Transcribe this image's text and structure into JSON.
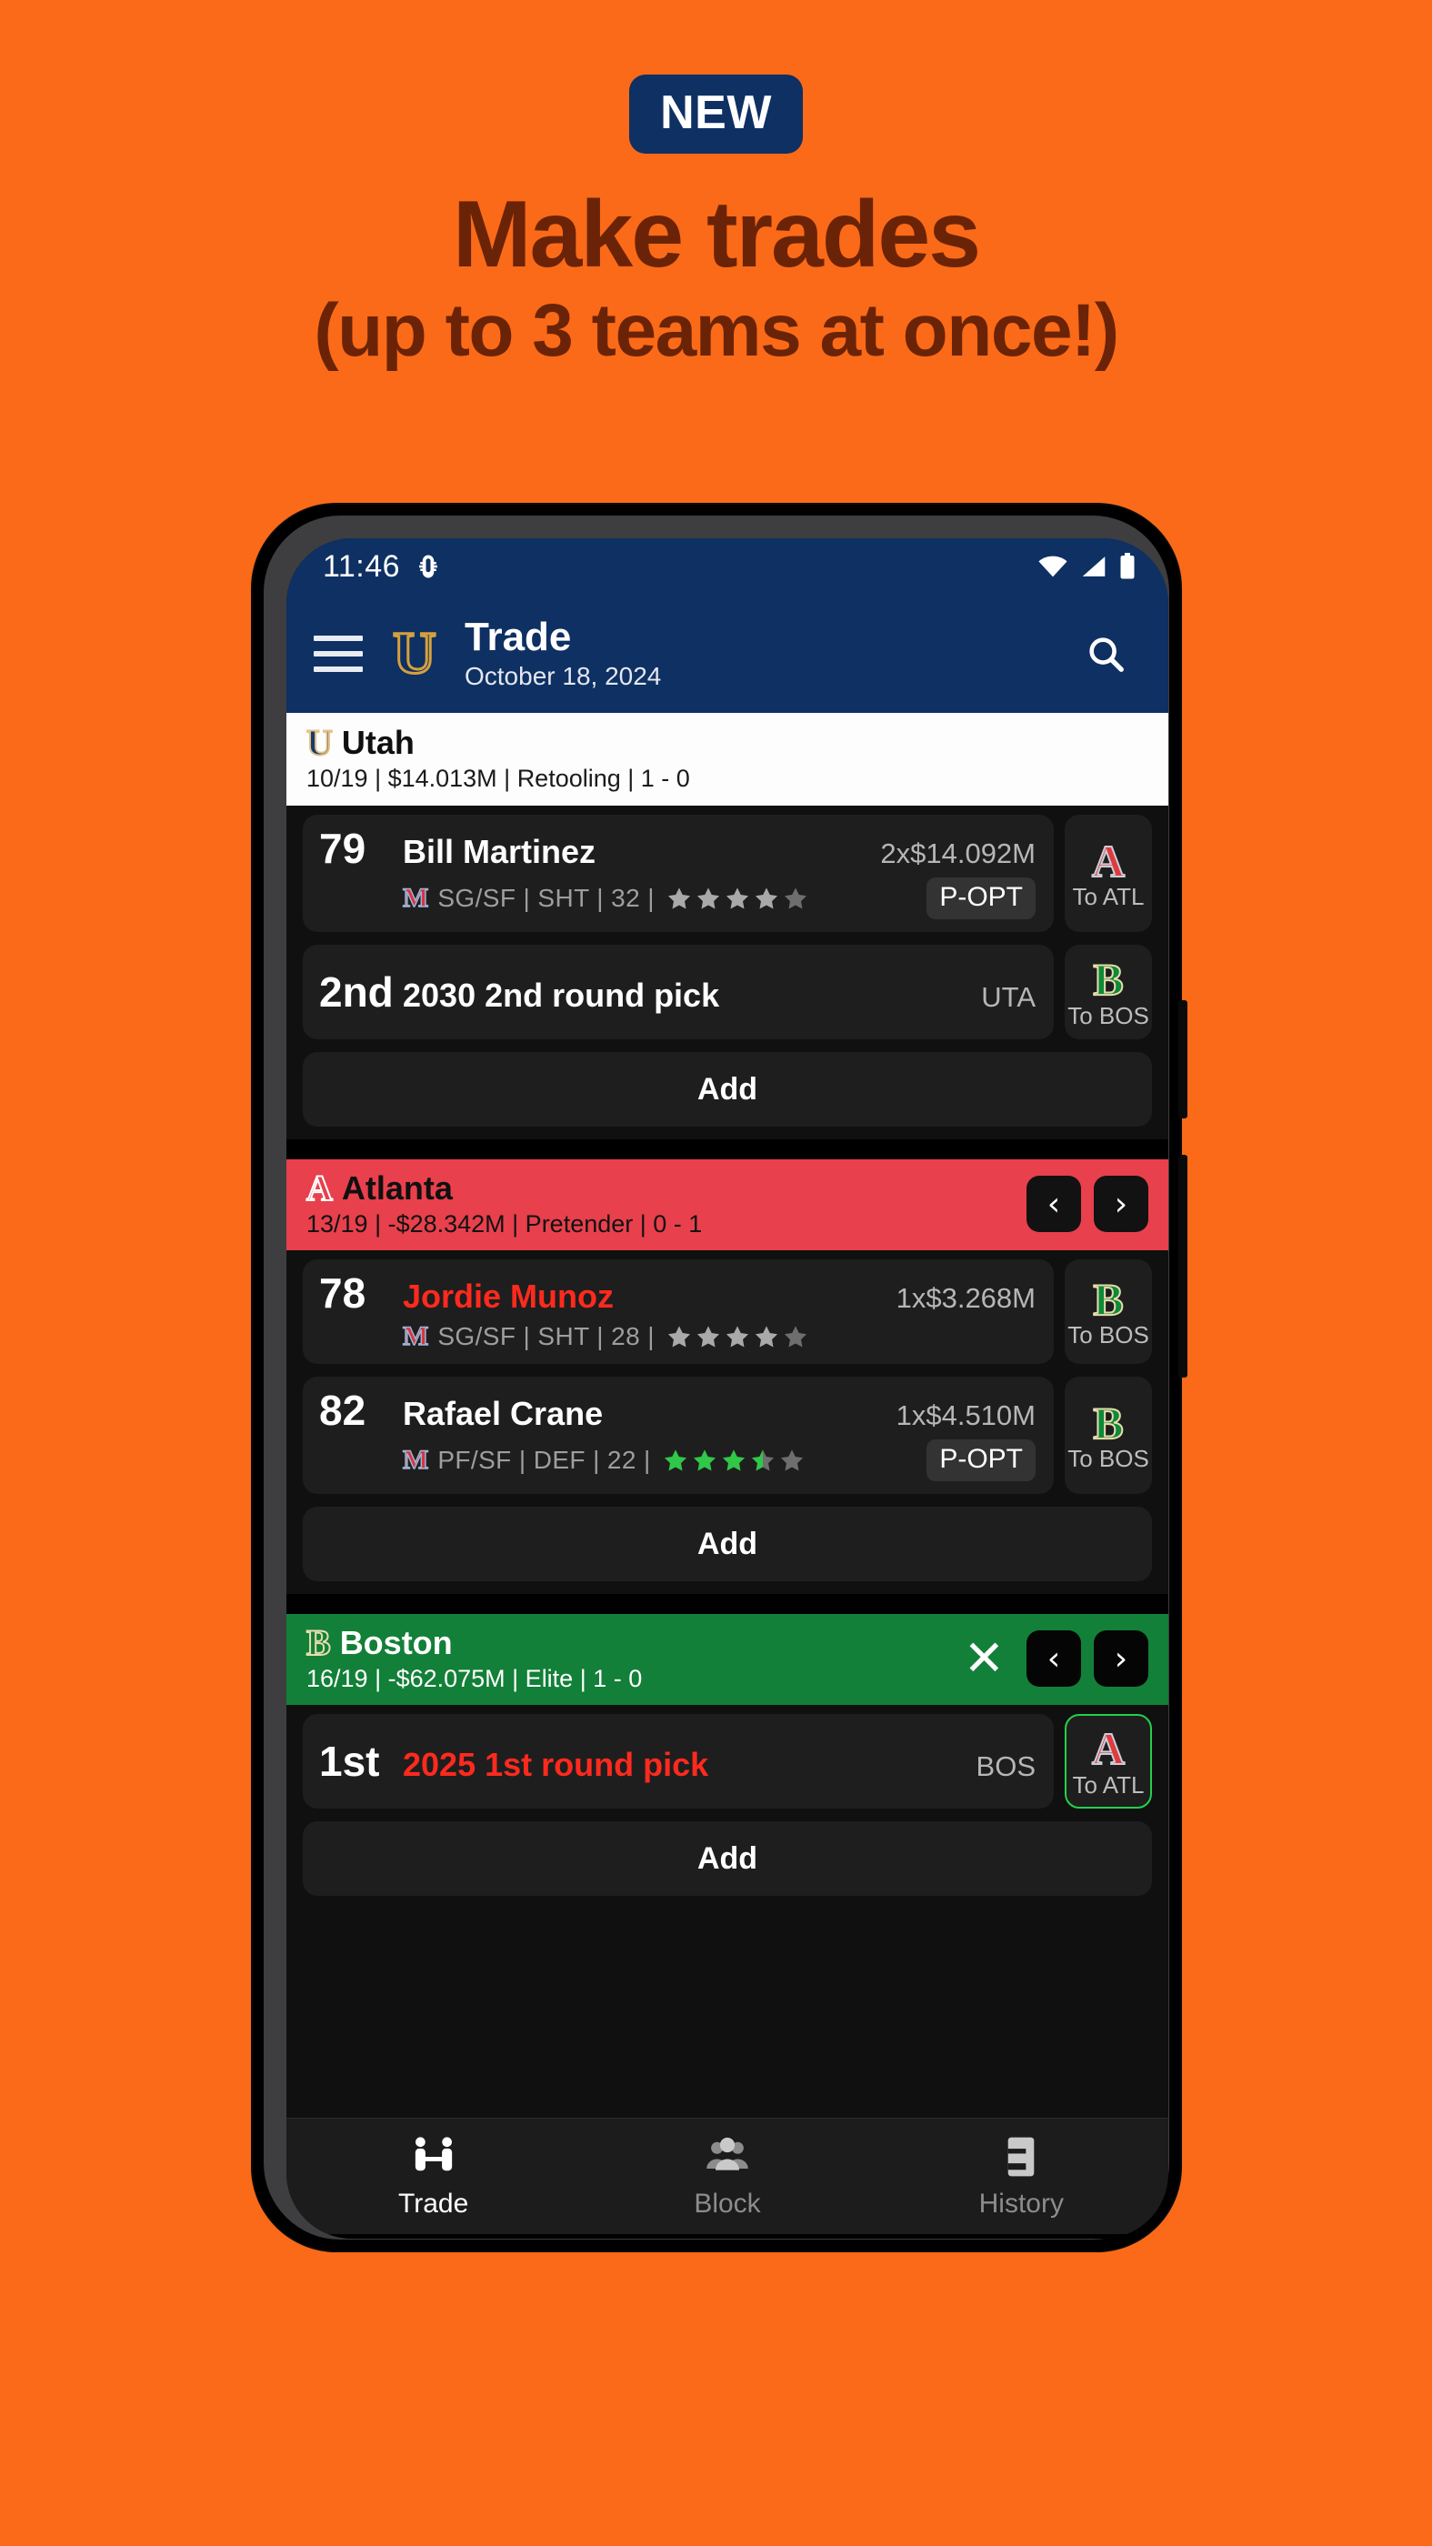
{
  "promo": {
    "badge": "NEW",
    "headline": "Make trades",
    "subheadline": "(up to 3 teams at once!)",
    "bg_color": "#FA6A18",
    "badge_bg": "#0E3063",
    "headline_color": "#6B2307"
  },
  "status_bar": {
    "time": "11:46",
    "left_icon": "bug-icon",
    "icons": [
      "wifi-icon",
      "signal-icon",
      "battery-icon"
    ]
  },
  "app_bar": {
    "menu_icon": "hamburger-menu-icon",
    "logo": "U",
    "title": "Trade",
    "date": "October 18, 2024",
    "search_icon": "search-icon",
    "bg_color": "#0E3063"
  },
  "teams": [
    {
      "id": "utah",
      "mark": "U",
      "name": "Utah",
      "meta": "10/19 | $14.013M | Retooling | 1 - 0",
      "bg_color": "#FDFDFD",
      "has_close": false,
      "has_nav": false,
      "assets": [
        {
          "type": "player",
          "ovr": "79",
          "name": "Bill Martinez",
          "name_color": "white",
          "contract": "2x$14.092M",
          "team_mark": "M",
          "attrs": "SG/SF | SHT | 32 |",
          "stars_filled": 0,
          "stars_half": 0,
          "stars_total": 5,
          "star_color": "#A9A9A9",
          "badge": "P-OPT",
          "destination": {
            "mark": "A",
            "label": "To ATL",
            "color_class": "a",
            "outlined": false
          }
        },
        {
          "type": "pick",
          "ovr": "2nd",
          "name": "2030 2nd round pick",
          "name_color": "white",
          "contract": "UTA",
          "destination": {
            "mark": "B",
            "label": "To BOS",
            "color_class": "b",
            "outlined": false
          }
        }
      ],
      "add_label": "Add"
    },
    {
      "id": "atlanta",
      "mark": "A",
      "name": "Atlanta",
      "meta": "13/19 | -$28.342M | Pretender | 0 - 1",
      "bg_color": "#E8404C",
      "has_close": false,
      "has_nav": true,
      "assets": [
        {
          "type": "player",
          "ovr": "78",
          "name": "Jordie Munoz",
          "name_color": "red",
          "contract": "1x$3.268M",
          "team_mark": "M",
          "attrs": "SG/SF | SHT | 28 |",
          "stars_filled": 0,
          "stars_half": 0,
          "stars_total": 5,
          "star_color": "#A9A9A9",
          "badge": "",
          "destination": {
            "mark": "B",
            "label": "To BOS",
            "color_class": "b",
            "outlined": false
          }
        },
        {
          "type": "player",
          "ovr": "82",
          "name": "Rafael Crane",
          "name_color": "white",
          "contract": "1x$4.510M",
          "team_mark": "M",
          "attrs": "PF/SF | DEF | 22 |",
          "stars_filled": 3,
          "stars_half": 1,
          "stars_total": 5,
          "star_color": "#31C748",
          "badge": "P-OPT",
          "destination": {
            "mark": "B",
            "label": "To BOS",
            "color_class": "b",
            "outlined": false
          }
        }
      ],
      "add_label": "Add"
    },
    {
      "id": "boston",
      "mark": "B",
      "name": "Boston",
      "meta": "16/19 | -$62.075M | Elite | 1 - 0",
      "bg_color": "#128038",
      "has_close": true,
      "has_nav": true,
      "assets": [
        {
          "type": "pick",
          "ovr": "1st",
          "name": "2025 1st round pick",
          "name_color": "red",
          "contract": "BOS",
          "destination": {
            "mark": "A",
            "label": "To ATL",
            "color_class": "a",
            "outlined": true
          }
        }
      ],
      "add_label": "Add"
    }
  ],
  "nav_buttons": {
    "prev": "‹",
    "next": "›",
    "close": "✕"
  },
  "bottom_nav": [
    {
      "label": "Trade",
      "icon": "handshake-icon",
      "active": true
    },
    {
      "label": "Block",
      "icon": "people-group-icon",
      "active": false
    },
    {
      "label": "History",
      "icon": "book-icon",
      "active": false
    }
  ]
}
